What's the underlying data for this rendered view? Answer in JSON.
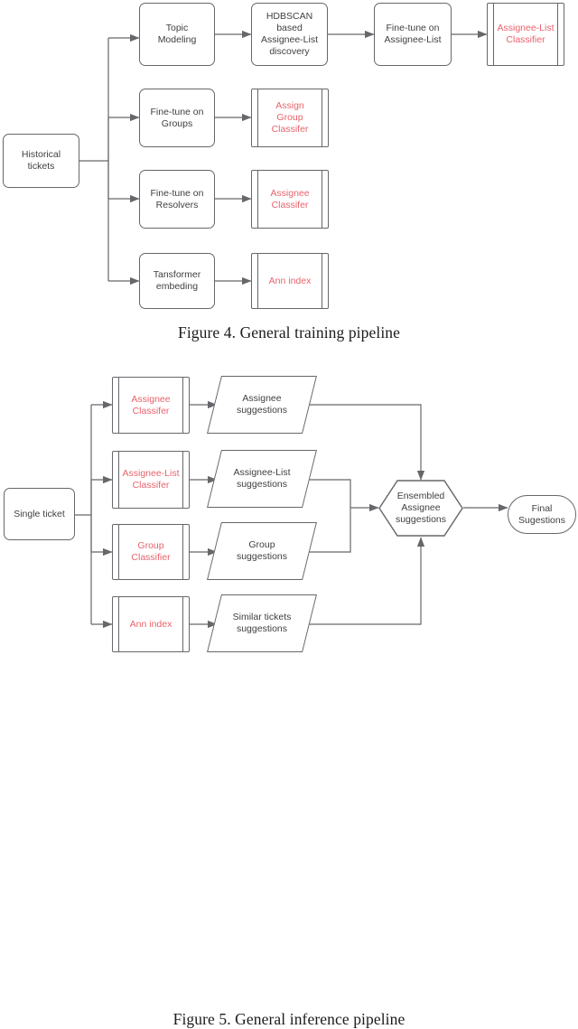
{
  "figures": [
    {
      "id": "training",
      "caption": "Figure 4. General training pipeline",
      "nodes": {
        "source": "Historical\ntickets",
        "topic_modeling": "Topic\nModeling",
        "hdbscan": "HDBSCAN\nbased\nAssignee-List\ndiscovery",
        "finetune_assignee_list": "Fine-tune on\nAssignee-List",
        "assignee_list_classifier": "Assignee-List\nClassifier",
        "finetune_groups": "Fine-tune on\nGroups",
        "assign_group_classifer": "Assign\nGroup\nClassifer",
        "finetune_resolvers": "Fine-tune on\nResolvers",
        "assignee_classifer": "Assignee\nClassifer",
        "transformer_embedding": "Tansformer\nembeding",
        "ann_index": "Ann index"
      }
    },
    {
      "id": "inference",
      "caption": "Figure 5. General inference pipeline",
      "nodes": {
        "source": "Single ticket",
        "assignee_classifer": "Assignee\nClassifer",
        "assignee_suggestions": "Assignee\nsuggestions",
        "assignee_list_classifer": "Assignee-List\nClassifer",
        "assignee_list_suggestions": "Assignee-List\nsuggestions",
        "group_classifier": "Group\nClassifier",
        "group_suggestions": "Group\nsuggestions",
        "ann_index": "Ann index",
        "similar_tickets_suggestions": "Similar tickets\nsuggestions",
        "ensembled": "Ensembled\nAssignee\nsuggestions",
        "final": "Final\nSugestions"
      }
    }
  ],
  "colors": {
    "stroke": "#66676b",
    "text": "#3f3f40",
    "accent_red": "#e8636c",
    "caption_text": "#1b1b1b",
    "background": "#ffffff"
  }
}
